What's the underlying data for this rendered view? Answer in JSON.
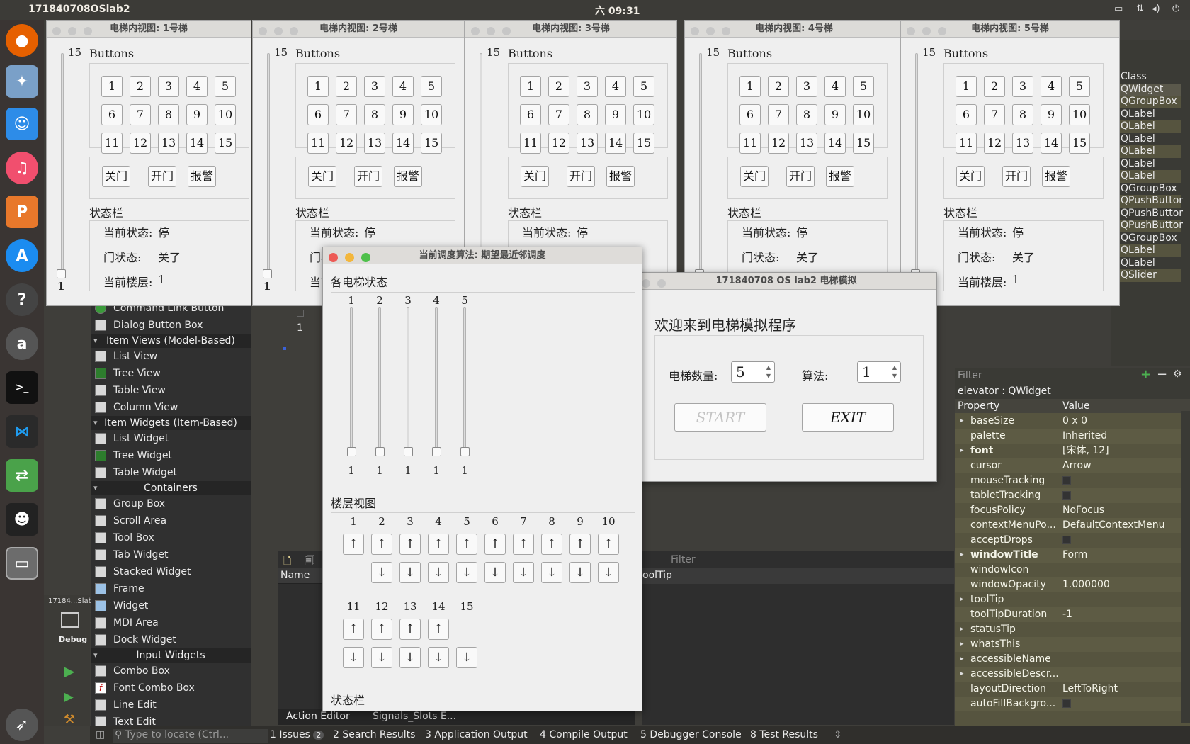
{
  "topbar": {
    "app_title": "171840708OSlab2",
    "clock": "六 09:31"
  },
  "creator": {
    "widget_box": {
      "items_top": [
        {
          "label": "Command Link Button"
        },
        {
          "label": "Dialog Button Box"
        }
      ],
      "cat_item_views": "Item Views (Model-Based)",
      "item_views": [
        "List View",
        "Tree View",
        "Table View",
        "Column View"
      ],
      "cat_item_widgets": "Item Widgets (Item-Based)",
      "item_widgets": [
        "List Widget",
        "Tree Widget",
        "Table Widget"
      ],
      "cat_containers": "Containers",
      "containers": [
        "Group Box",
        "Scroll Area",
        "Tool Box",
        "Tab Widget",
        "Stacked Widget",
        "Frame",
        "Widget",
        "MDI Area",
        "Dock Widget"
      ],
      "cat_input": "Input Widgets",
      "inputs": [
        "Combo Box",
        "Font Combo Box",
        "Line Edit",
        "Text Edit"
      ]
    },
    "project_label": "17184...Slab2",
    "debug_label": "Debug",
    "action_editor_tab": "Action Editor",
    "signals_slots_tab": "Signals_Slots E...",
    "filter_placeholder": "Filter",
    "name_header": "Name",
    "tooltip_header": "oolTip",
    "form_value": "1",
    "object_class_header": "Class",
    "classes": [
      "QWidget",
      "QGroupBox",
      "QLabel",
      "QLabel",
      "QLabel",
      "QLabel",
      "QLabel",
      "QLabel",
      "QGroupBox",
      "QPushButtor",
      "QPushButtor",
      "QPushButtor",
      "QGroupBox",
      "QLabel",
      "QLabel",
      "QSlider"
    ],
    "prop_filter_placeholder": "Filter",
    "prop_object": "elevator : QWidget",
    "prop_header_property": "Property",
    "prop_header_value": "Value",
    "properties": [
      {
        "name": "baseSize",
        "value": "0 x 0",
        "expandable": true
      },
      {
        "name": "palette",
        "value": "Inherited",
        "expandable": false
      },
      {
        "name": "font",
        "value": "[宋体, 12]",
        "expandable": true
      },
      {
        "name": "cursor",
        "value": "Arrow",
        "expandable": false
      },
      {
        "name": "mouseTracking",
        "value": "",
        "expandable": false
      },
      {
        "name": "tabletTracking",
        "value": "",
        "expandable": false
      },
      {
        "name": "focusPolicy",
        "value": "NoFocus",
        "expandable": false
      },
      {
        "name": "contextMenuPo...",
        "value": "DefaultContextMenu",
        "expandable": false
      },
      {
        "name": "acceptDrops",
        "value": "",
        "expandable": false
      },
      {
        "name": "windowTitle",
        "value": "Form",
        "expandable": true
      },
      {
        "name": "windowIcon",
        "value": "",
        "expandable": false
      },
      {
        "name": "windowOpacity",
        "value": "1.000000",
        "expandable": false
      },
      {
        "name": "toolTip",
        "value": "",
        "expandable": true
      },
      {
        "name": "toolTipDuration",
        "value": "-1",
        "expandable": false
      },
      {
        "name": "statusTip",
        "value": "",
        "expandable": true
      },
      {
        "name": "whatsThis",
        "value": "",
        "expandable": true
      },
      {
        "name": "accessibleName",
        "value": "",
        "expandable": true
      },
      {
        "name": "accessibleDescr...",
        "value": "",
        "expandable": true
      },
      {
        "name": "layoutDirection",
        "value": "LeftToRight",
        "expandable": false
      },
      {
        "name": "autoFillBackgro...",
        "value": "",
        "expandable": false
      }
    ],
    "locate_placeholder": "Type to locate (Ctrl...",
    "bottom_tabs": [
      {
        "label": "1 Issues",
        "badge": "2"
      },
      {
        "label": "2 Search Results"
      },
      {
        "label": "3 Application Output"
      },
      {
        "label": "4 Compile Output"
      },
      {
        "label": "5 Debugger Console"
      },
      {
        "label": "8 Test Results"
      }
    ]
  },
  "elevator_window": {
    "group_buttons": "Buttons",
    "slider_max": "15",
    "slider_value": "1",
    "floors": [
      "1",
      "2",
      "3",
      "4",
      "5",
      "6",
      "7",
      "8",
      "9",
      "10",
      "11",
      "12",
      "13",
      "14",
      "15"
    ],
    "close_door": "关门",
    "open_door": "开门",
    "alarm": "报警",
    "group_status": "状态栏",
    "state_label": "当前状态:",
    "state_value": "停",
    "door_label": "门状态:",
    "door_value": "关了",
    "floor_label": "当前楼层:",
    "floor_value": "1"
  },
  "elevator_titles": [
    "电梯内视图: 1号梯",
    "电梯内视图: 2号梯",
    "电梯内视图: 3号梯",
    "电梯内视图: 4号梯",
    "电梯内视图: 5号梯"
  ],
  "scheduler": {
    "title": "当前调度算法: 期望最近邻调度",
    "group_elevators": "各电梯状态",
    "elevator_ids": [
      "1",
      "2",
      "3",
      "4",
      "5"
    ],
    "elevator_floors": [
      "1",
      "1",
      "1",
      "1",
      "1"
    ],
    "elevator_levels": [
      1,
      1,
      1,
      1,
      1
    ],
    "group_floors": "楼层视图",
    "floor_row1": [
      "1",
      "2",
      "3",
      "4",
      "5",
      "6",
      "7",
      "8",
      "9",
      "10"
    ],
    "floor_row2": [
      "11",
      "12",
      "13",
      "14",
      "15"
    ],
    "up_arrow": "↑",
    "down_arrow": "↓",
    "group_status": "状态栏"
  },
  "main_window": {
    "title": "171840708 OS lab2 电梯模拟",
    "welcome": "欢迎来到电梯模拟程序",
    "count_label": "电梯数量:",
    "count_value": "5",
    "algo_label": "算法:",
    "algo_value": "1",
    "start_label": "START",
    "exit_label": "EXIT"
  },
  "colors": {
    "close_red": "#ed5a55",
    "min_yellow": "#f3b63b",
    "max_green": "#4ec04a",
    "ubuntu_bar": "#3c3b37",
    "prop_panel": "#56543f"
  }
}
